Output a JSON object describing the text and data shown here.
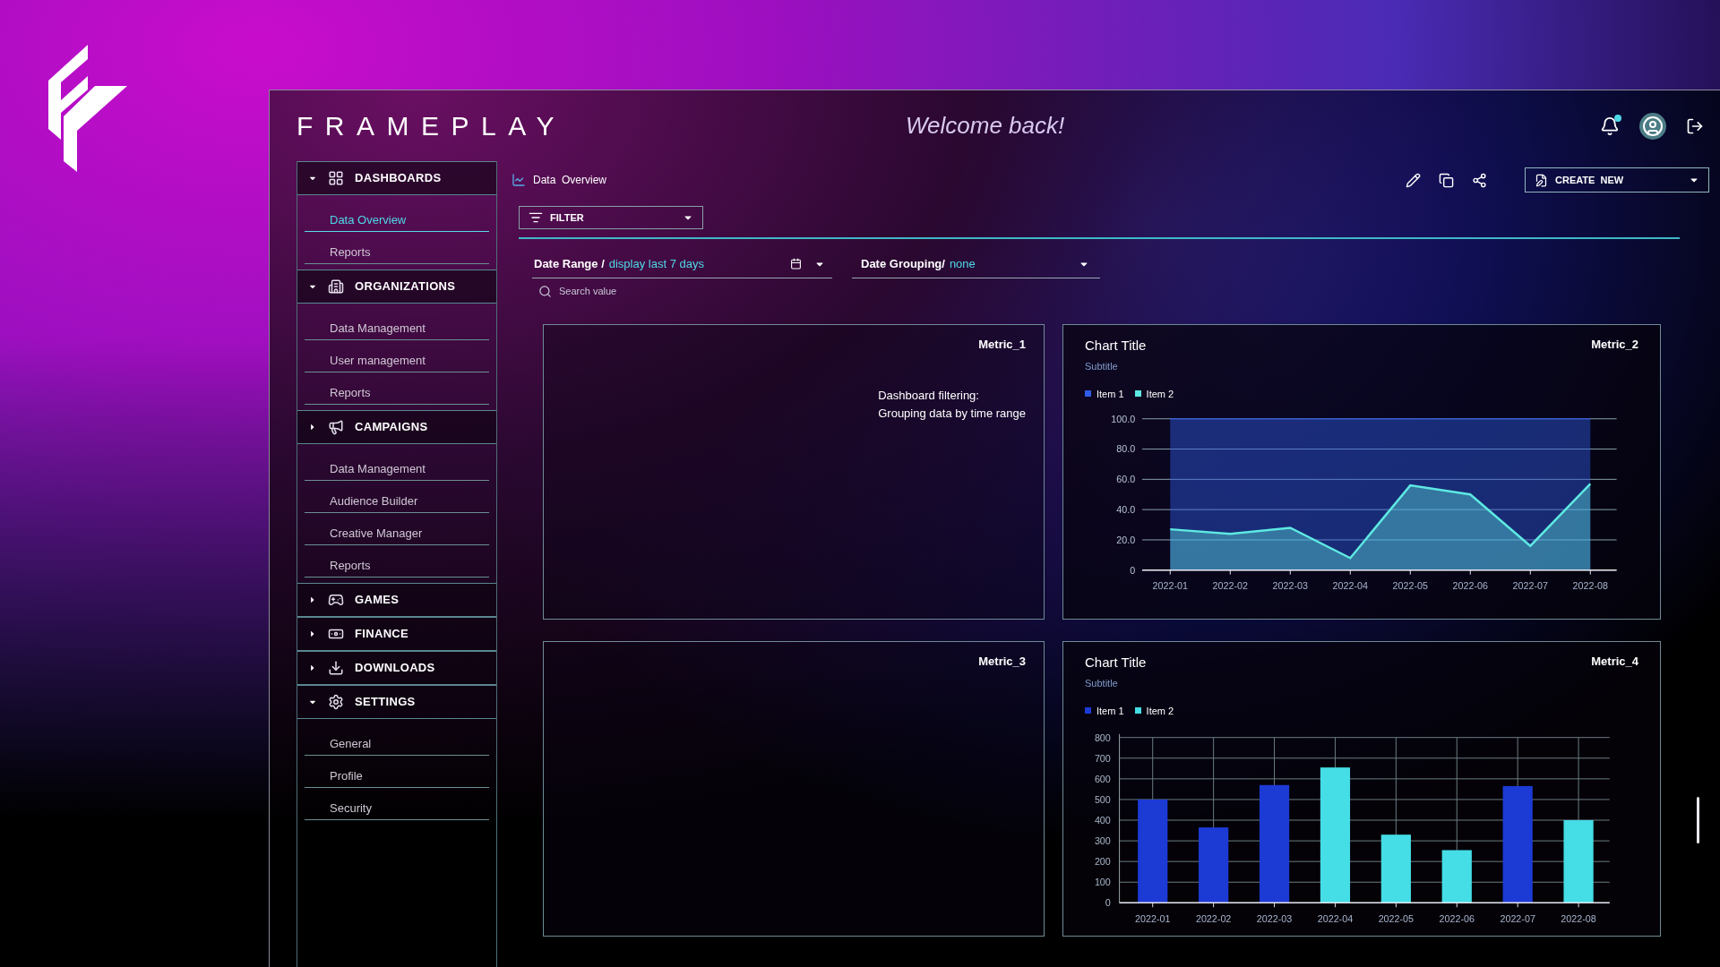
{
  "header": {
    "brand": "FRAMEPLAY",
    "greeting": "Welcome back!",
    "notifications_unread": true
  },
  "sidebar": {
    "groups": [
      {
        "label": "DASHBOARDS",
        "expanded": true,
        "children": [
          {
            "label": "Data Overview",
            "selected": true
          },
          {
            "label": "Reports",
            "selected": false
          }
        ]
      },
      {
        "label": "ORGANIZATIONS",
        "expanded": true,
        "children": [
          {
            "label": "Data Management",
            "selected": false
          },
          {
            "label": "User management",
            "selected": false
          },
          {
            "label": "Reports",
            "selected": false
          }
        ]
      },
      {
        "label": "CAMPAIGNS",
        "expanded": false,
        "children": [
          {
            "label": "Data Management",
            "selected": false
          },
          {
            "label": "Audience Builder",
            "selected": false
          },
          {
            "label": "Creative Manager",
            "selected": false
          },
          {
            "label": "Reports",
            "selected": false
          }
        ]
      },
      {
        "label": "GAMES",
        "expanded": false
      },
      {
        "label": "FINANCE",
        "expanded": false
      },
      {
        "label": "DOWNLOADS",
        "expanded": false
      },
      {
        "label": "SETTINGS",
        "expanded": true,
        "children": [
          {
            "label": "General",
            "selected": false
          },
          {
            "label": "Profile",
            "selected": false
          },
          {
            "label": "Security",
            "selected": false
          }
        ]
      }
    ]
  },
  "toolbar": {
    "breadcrumb": "Data  Overview",
    "create_button": "CREATE  NEW"
  },
  "filter": {
    "button": "FILTER",
    "date_range": {
      "label": "Date Range /",
      "value": "display last 7 days"
    },
    "date_grouping": {
      "label": "Date Grouping/",
      "value": "none"
    },
    "search": {
      "placeholder": "Search value"
    }
  },
  "panels": [
    {
      "kind": "empty",
      "metric": "Metric_1",
      "note": [
        "Dashboard filtering:",
        "Grouping data by time range"
      ]
    },
    {
      "kind": "chart",
      "metric": "Metric_2",
      "subtitle": "Subtitle",
      "chart_data": {
        "type": "area",
        "title": "Chart Title",
        "categories": [
          "2022-01",
          "2022-02",
          "2022-03",
          "2022-04",
          "2022-05",
          "2022-06",
          "2022-07",
          "2022-08"
        ],
        "series": [
          {
            "name": "Item 1",
            "color": "#2f5ce6",
            "values": [
              100,
              100,
              100,
              100,
              100,
              100,
              100,
              100
            ]
          },
          {
            "name": "Item 2",
            "color": "#5ee9e2",
            "values": [
              27,
              24,
              28,
              8,
              56,
              50,
              16,
              57
            ]
          }
        ],
        "grid": true,
        "ylim": [
          0,
          100
        ],
        "yticks": [
          {
            "value": 0,
            "label": "0"
          },
          {
            "value": 20,
            "label": "20.0"
          },
          {
            "value": 40,
            "label": "40.0"
          },
          {
            "value": 60,
            "label": "60.0"
          },
          {
            "value": 80,
            "label": "80.0"
          },
          {
            "value": 100,
            "label": "100.0"
          }
        ]
      }
    },
    {
      "kind": "empty",
      "metric": "Metric_3"
    },
    {
      "kind": "chart",
      "metric": "Metric_4",
      "subtitle": "Subtitle",
      "chart_data": {
        "type": "bar",
        "title": "Chart Title",
        "categories": [
          "2022-01",
          "2022-02",
          "2022-03",
          "2022-04",
          "2022-05",
          "2022-06",
          "2022-07",
          "2022-08"
        ],
        "series": [
          {
            "name": "Item 1",
            "color": "#1c3ad4",
            "values": [
              500,
              365,
              570,
              null,
              null,
              null,
              565,
              null
            ]
          },
          {
            "name": "Item 2",
            "color": "#45dde6",
            "values": [
              null,
              null,
              null,
              655,
              330,
              255,
              null,
              400
            ]
          }
        ],
        "grid": true,
        "ylim": [
          0,
          800
        ],
        "yticks": [
          0,
          100,
          200,
          300,
          400,
          500,
          600,
          700,
          800
        ]
      }
    }
  ]
}
